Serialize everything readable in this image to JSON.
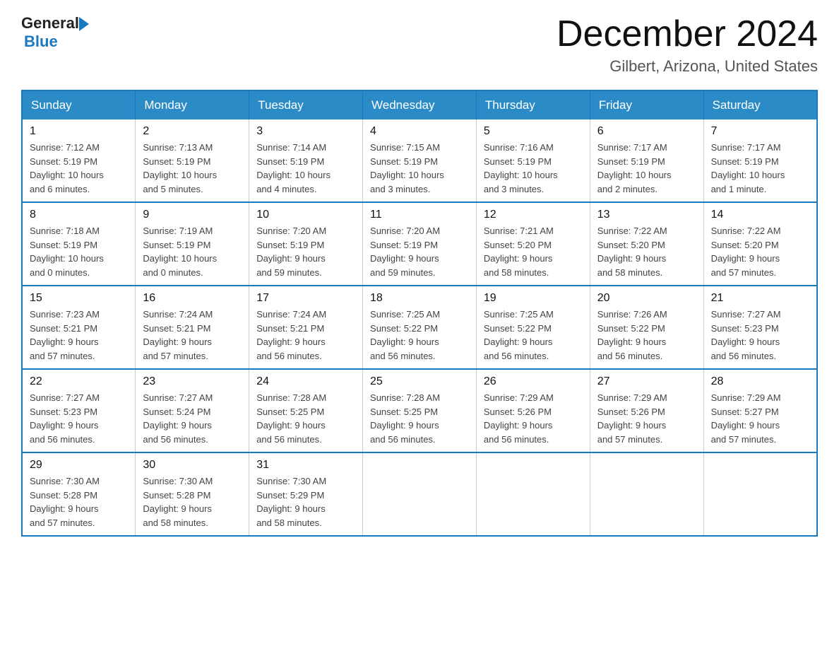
{
  "header": {
    "logo_general": "General",
    "logo_blue": "Blue",
    "month_title": "December 2024",
    "location": "Gilbert, Arizona, United States"
  },
  "days_of_week": [
    "Sunday",
    "Monday",
    "Tuesday",
    "Wednesday",
    "Thursday",
    "Friday",
    "Saturday"
  ],
  "weeks": [
    [
      {
        "day": "1",
        "info": "Sunrise: 7:12 AM\nSunset: 5:19 PM\nDaylight: 10 hours\nand 6 minutes."
      },
      {
        "day": "2",
        "info": "Sunrise: 7:13 AM\nSunset: 5:19 PM\nDaylight: 10 hours\nand 5 minutes."
      },
      {
        "day": "3",
        "info": "Sunrise: 7:14 AM\nSunset: 5:19 PM\nDaylight: 10 hours\nand 4 minutes."
      },
      {
        "day": "4",
        "info": "Sunrise: 7:15 AM\nSunset: 5:19 PM\nDaylight: 10 hours\nand 3 minutes."
      },
      {
        "day": "5",
        "info": "Sunrise: 7:16 AM\nSunset: 5:19 PM\nDaylight: 10 hours\nand 3 minutes."
      },
      {
        "day": "6",
        "info": "Sunrise: 7:17 AM\nSunset: 5:19 PM\nDaylight: 10 hours\nand 2 minutes."
      },
      {
        "day": "7",
        "info": "Sunrise: 7:17 AM\nSunset: 5:19 PM\nDaylight: 10 hours\nand 1 minute."
      }
    ],
    [
      {
        "day": "8",
        "info": "Sunrise: 7:18 AM\nSunset: 5:19 PM\nDaylight: 10 hours\nand 0 minutes."
      },
      {
        "day": "9",
        "info": "Sunrise: 7:19 AM\nSunset: 5:19 PM\nDaylight: 10 hours\nand 0 minutes."
      },
      {
        "day": "10",
        "info": "Sunrise: 7:20 AM\nSunset: 5:19 PM\nDaylight: 9 hours\nand 59 minutes."
      },
      {
        "day": "11",
        "info": "Sunrise: 7:20 AM\nSunset: 5:19 PM\nDaylight: 9 hours\nand 59 minutes."
      },
      {
        "day": "12",
        "info": "Sunrise: 7:21 AM\nSunset: 5:20 PM\nDaylight: 9 hours\nand 58 minutes."
      },
      {
        "day": "13",
        "info": "Sunrise: 7:22 AM\nSunset: 5:20 PM\nDaylight: 9 hours\nand 58 minutes."
      },
      {
        "day": "14",
        "info": "Sunrise: 7:22 AM\nSunset: 5:20 PM\nDaylight: 9 hours\nand 57 minutes."
      }
    ],
    [
      {
        "day": "15",
        "info": "Sunrise: 7:23 AM\nSunset: 5:21 PM\nDaylight: 9 hours\nand 57 minutes."
      },
      {
        "day": "16",
        "info": "Sunrise: 7:24 AM\nSunset: 5:21 PM\nDaylight: 9 hours\nand 57 minutes."
      },
      {
        "day": "17",
        "info": "Sunrise: 7:24 AM\nSunset: 5:21 PM\nDaylight: 9 hours\nand 56 minutes."
      },
      {
        "day": "18",
        "info": "Sunrise: 7:25 AM\nSunset: 5:22 PM\nDaylight: 9 hours\nand 56 minutes."
      },
      {
        "day": "19",
        "info": "Sunrise: 7:25 AM\nSunset: 5:22 PM\nDaylight: 9 hours\nand 56 minutes."
      },
      {
        "day": "20",
        "info": "Sunrise: 7:26 AM\nSunset: 5:22 PM\nDaylight: 9 hours\nand 56 minutes."
      },
      {
        "day": "21",
        "info": "Sunrise: 7:27 AM\nSunset: 5:23 PM\nDaylight: 9 hours\nand 56 minutes."
      }
    ],
    [
      {
        "day": "22",
        "info": "Sunrise: 7:27 AM\nSunset: 5:23 PM\nDaylight: 9 hours\nand 56 minutes."
      },
      {
        "day": "23",
        "info": "Sunrise: 7:27 AM\nSunset: 5:24 PM\nDaylight: 9 hours\nand 56 minutes."
      },
      {
        "day": "24",
        "info": "Sunrise: 7:28 AM\nSunset: 5:25 PM\nDaylight: 9 hours\nand 56 minutes."
      },
      {
        "day": "25",
        "info": "Sunrise: 7:28 AM\nSunset: 5:25 PM\nDaylight: 9 hours\nand 56 minutes."
      },
      {
        "day": "26",
        "info": "Sunrise: 7:29 AM\nSunset: 5:26 PM\nDaylight: 9 hours\nand 56 minutes."
      },
      {
        "day": "27",
        "info": "Sunrise: 7:29 AM\nSunset: 5:26 PM\nDaylight: 9 hours\nand 57 minutes."
      },
      {
        "day": "28",
        "info": "Sunrise: 7:29 AM\nSunset: 5:27 PM\nDaylight: 9 hours\nand 57 minutes."
      }
    ],
    [
      {
        "day": "29",
        "info": "Sunrise: 7:30 AM\nSunset: 5:28 PM\nDaylight: 9 hours\nand 57 minutes."
      },
      {
        "day": "30",
        "info": "Sunrise: 7:30 AM\nSunset: 5:28 PM\nDaylight: 9 hours\nand 58 minutes."
      },
      {
        "day": "31",
        "info": "Sunrise: 7:30 AM\nSunset: 5:29 PM\nDaylight: 9 hours\nand 58 minutes."
      },
      null,
      null,
      null,
      null
    ]
  ]
}
